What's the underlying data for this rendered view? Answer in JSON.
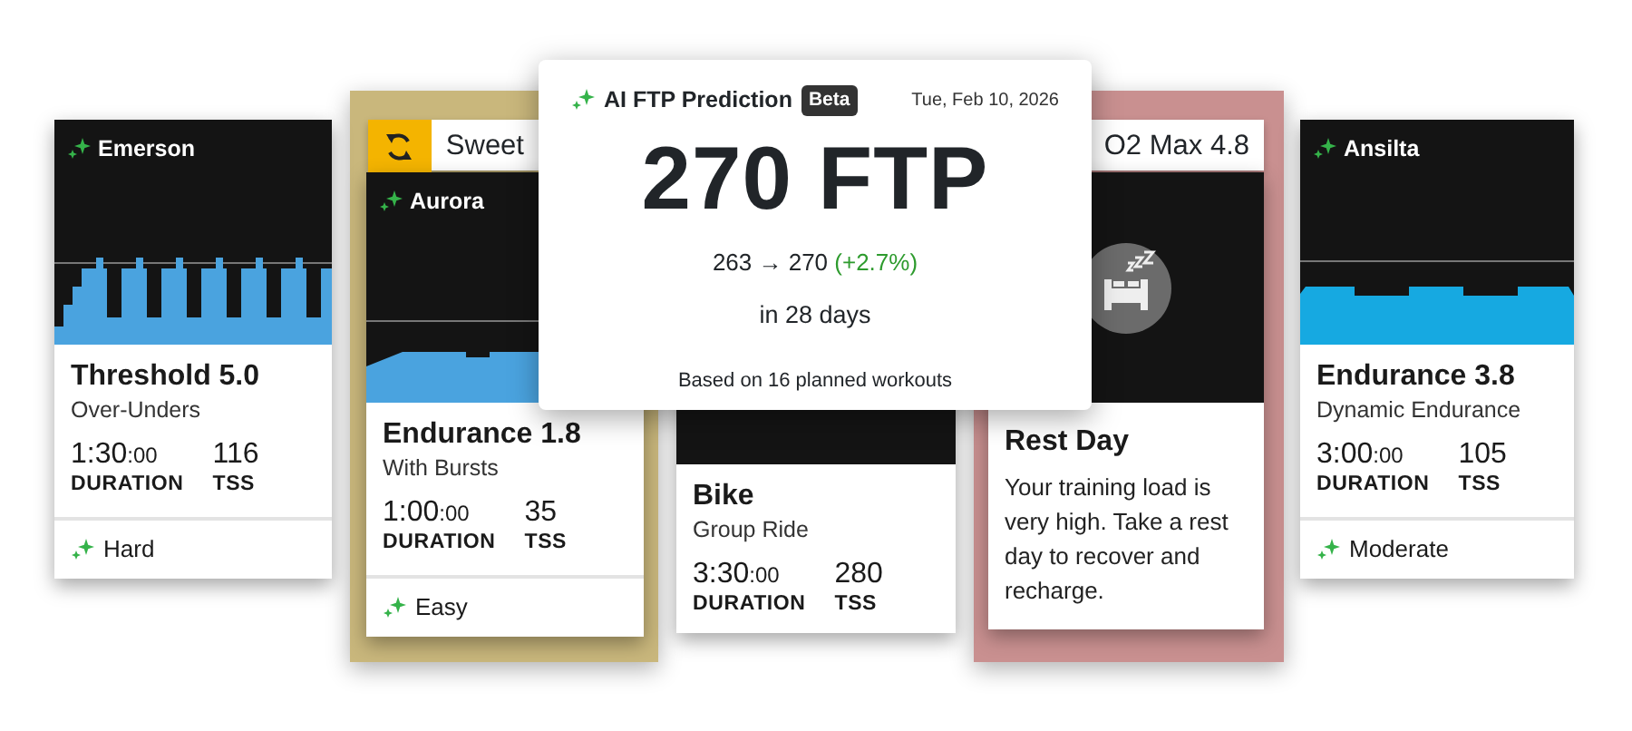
{
  "cards": [
    {
      "kind": "workout",
      "coach": "Emerson",
      "title": "Threshold 5.0",
      "subtitle": "Over-Unders",
      "duration": "1:30:00",
      "duration_label": "DURATION",
      "tss": "116",
      "tss_label": "TSS",
      "difficulty": "Hard"
    },
    {
      "kind": "workout",
      "backdrop": {
        "color": "#c9b77c",
        "tab": "Sweet",
        "swap_icon": true
      },
      "coach": "Aurora",
      "title": "Endurance 1.8",
      "subtitle": "With Bursts",
      "duration": "1:00:00",
      "duration_label": "DURATION",
      "tss": "35",
      "tss_label": "TSS",
      "difficulty": "Easy"
    },
    {
      "kind": "workout",
      "title": "Bike",
      "subtitle": "Group Ride",
      "duration": "3:30:00",
      "duration_label": "DURATION",
      "tss": "280",
      "tss_label": "TSS"
    },
    {
      "kind": "rest",
      "backdrop": {
        "color": "#c99090",
        "tab": "O2 Max 4.8"
      },
      "title": "Rest Day",
      "text": "Your training load is very high. Take a rest day to recover and recharge."
    },
    {
      "kind": "workout",
      "coach": "Ansilta",
      "title": "Endurance 3.8",
      "subtitle": "Dynamic Endurance",
      "duration": "3:00:00",
      "duration_label": "DURATION",
      "tss": "105",
      "tss_label": "TSS",
      "difficulty": "Moderate"
    }
  ],
  "prediction": {
    "title": "AI FTP Prediction",
    "badge": "Beta",
    "date": "Tue, Feb 10, 2026",
    "value": "270 FTP",
    "from": "263",
    "arrow": "→",
    "to": "270",
    "change": "(+2.7%)",
    "period": "in 28 days",
    "basis": "Based on 16 planned workouts"
  }
}
